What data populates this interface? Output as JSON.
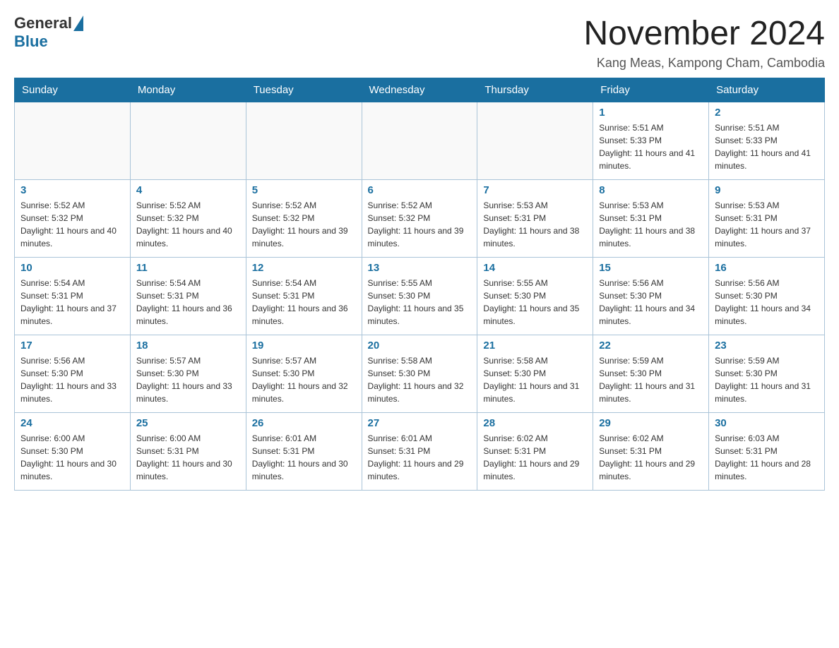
{
  "header": {
    "logo_general": "General",
    "logo_blue": "Blue",
    "month_title": "November 2024",
    "location": "Kang Meas, Kampong Cham, Cambodia"
  },
  "weekdays": [
    "Sunday",
    "Monday",
    "Tuesday",
    "Wednesday",
    "Thursday",
    "Friday",
    "Saturday"
  ],
  "weeks": [
    [
      {
        "day": "",
        "sunrise": "",
        "sunset": "",
        "daylight": ""
      },
      {
        "day": "",
        "sunrise": "",
        "sunset": "",
        "daylight": ""
      },
      {
        "day": "",
        "sunrise": "",
        "sunset": "",
        "daylight": ""
      },
      {
        "day": "",
        "sunrise": "",
        "sunset": "",
        "daylight": ""
      },
      {
        "day": "",
        "sunrise": "",
        "sunset": "",
        "daylight": ""
      },
      {
        "day": "1",
        "sunrise": "Sunrise: 5:51 AM",
        "sunset": "Sunset: 5:33 PM",
        "daylight": "Daylight: 11 hours and 41 minutes."
      },
      {
        "day": "2",
        "sunrise": "Sunrise: 5:51 AM",
        "sunset": "Sunset: 5:33 PM",
        "daylight": "Daylight: 11 hours and 41 minutes."
      }
    ],
    [
      {
        "day": "3",
        "sunrise": "Sunrise: 5:52 AM",
        "sunset": "Sunset: 5:32 PM",
        "daylight": "Daylight: 11 hours and 40 minutes."
      },
      {
        "day": "4",
        "sunrise": "Sunrise: 5:52 AM",
        "sunset": "Sunset: 5:32 PM",
        "daylight": "Daylight: 11 hours and 40 minutes."
      },
      {
        "day": "5",
        "sunrise": "Sunrise: 5:52 AM",
        "sunset": "Sunset: 5:32 PM",
        "daylight": "Daylight: 11 hours and 39 minutes."
      },
      {
        "day": "6",
        "sunrise": "Sunrise: 5:52 AM",
        "sunset": "Sunset: 5:32 PM",
        "daylight": "Daylight: 11 hours and 39 minutes."
      },
      {
        "day": "7",
        "sunrise": "Sunrise: 5:53 AM",
        "sunset": "Sunset: 5:31 PM",
        "daylight": "Daylight: 11 hours and 38 minutes."
      },
      {
        "day": "8",
        "sunrise": "Sunrise: 5:53 AM",
        "sunset": "Sunset: 5:31 PM",
        "daylight": "Daylight: 11 hours and 38 minutes."
      },
      {
        "day": "9",
        "sunrise": "Sunrise: 5:53 AM",
        "sunset": "Sunset: 5:31 PM",
        "daylight": "Daylight: 11 hours and 37 minutes."
      }
    ],
    [
      {
        "day": "10",
        "sunrise": "Sunrise: 5:54 AM",
        "sunset": "Sunset: 5:31 PM",
        "daylight": "Daylight: 11 hours and 37 minutes."
      },
      {
        "day": "11",
        "sunrise": "Sunrise: 5:54 AM",
        "sunset": "Sunset: 5:31 PM",
        "daylight": "Daylight: 11 hours and 36 minutes."
      },
      {
        "day": "12",
        "sunrise": "Sunrise: 5:54 AM",
        "sunset": "Sunset: 5:31 PM",
        "daylight": "Daylight: 11 hours and 36 minutes."
      },
      {
        "day": "13",
        "sunrise": "Sunrise: 5:55 AM",
        "sunset": "Sunset: 5:30 PM",
        "daylight": "Daylight: 11 hours and 35 minutes."
      },
      {
        "day": "14",
        "sunrise": "Sunrise: 5:55 AM",
        "sunset": "Sunset: 5:30 PM",
        "daylight": "Daylight: 11 hours and 35 minutes."
      },
      {
        "day": "15",
        "sunrise": "Sunrise: 5:56 AM",
        "sunset": "Sunset: 5:30 PM",
        "daylight": "Daylight: 11 hours and 34 minutes."
      },
      {
        "day": "16",
        "sunrise": "Sunrise: 5:56 AM",
        "sunset": "Sunset: 5:30 PM",
        "daylight": "Daylight: 11 hours and 34 minutes."
      }
    ],
    [
      {
        "day": "17",
        "sunrise": "Sunrise: 5:56 AM",
        "sunset": "Sunset: 5:30 PM",
        "daylight": "Daylight: 11 hours and 33 minutes."
      },
      {
        "day": "18",
        "sunrise": "Sunrise: 5:57 AM",
        "sunset": "Sunset: 5:30 PM",
        "daylight": "Daylight: 11 hours and 33 minutes."
      },
      {
        "day": "19",
        "sunrise": "Sunrise: 5:57 AM",
        "sunset": "Sunset: 5:30 PM",
        "daylight": "Daylight: 11 hours and 32 minutes."
      },
      {
        "day": "20",
        "sunrise": "Sunrise: 5:58 AM",
        "sunset": "Sunset: 5:30 PM",
        "daylight": "Daylight: 11 hours and 32 minutes."
      },
      {
        "day": "21",
        "sunrise": "Sunrise: 5:58 AM",
        "sunset": "Sunset: 5:30 PM",
        "daylight": "Daylight: 11 hours and 31 minutes."
      },
      {
        "day": "22",
        "sunrise": "Sunrise: 5:59 AM",
        "sunset": "Sunset: 5:30 PM",
        "daylight": "Daylight: 11 hours and 31 minutes."
      },
      {
        "day": "23",
        "sunrise": "Sunrise: 5:59 AM",
        "sunset": "Sunset: 5:30 PM",
        "daylight": "Daylight: 11 hours and 31 minutes."
      }
    ],
    [
      {
        "day": "24",
        "sunrise": "Sunrise: 6:00 AM",
        "sunset": "Sunset: 5:30 PM",
        "daylight": "Daylight: 11 hours and 30 minutes."
      },
      {
        "day": "25",
        "sunrise": "Sunrise: 6:00 AM",
        "sunset": "Sunset: 5:31 PM",
        "daylight": "Daylight: 11 hours and 30 minutes."
      },
      {
        "day": "26",
        "sunrise": "Sunrise: 6:01 AM",
        "sunset": "Sunset: 5:31 PM",
        "daylight": "Daylight: 11 hours and 30 minutes."
      },
      {
        "day": "27",
        "sunrise": "Sunrise: 6:01 AM",
        "sunset": "Sunset: 5:31 PM",
        "daylight": "Daylight: 11 hours and 29 minutes."
      },
      {
        "day": "28",
        "sunrise": "Sunrise: 6:02 AM",
        "sunset": "Sunset: 5:31 PM",
        "daylight": "Daylight: 11 hours and 29 minutes."
      },
      {
        "day": "29",
        "sunrise": "Sunrise: 6:02 AM",
        "sunset": "Sunset: 5:31 PM",
        "daylight": "Daylight: 11 hours and 29 minutes."
      },
      {
        "day": "30",
        "sunrise": "Sunrise: 6:03 AM",
        "sunset": "Sunset: 5:31 PM",
        "daylight": "Daylight: 11 hours and 28 minutes."
      }
    ]
  ]
}
